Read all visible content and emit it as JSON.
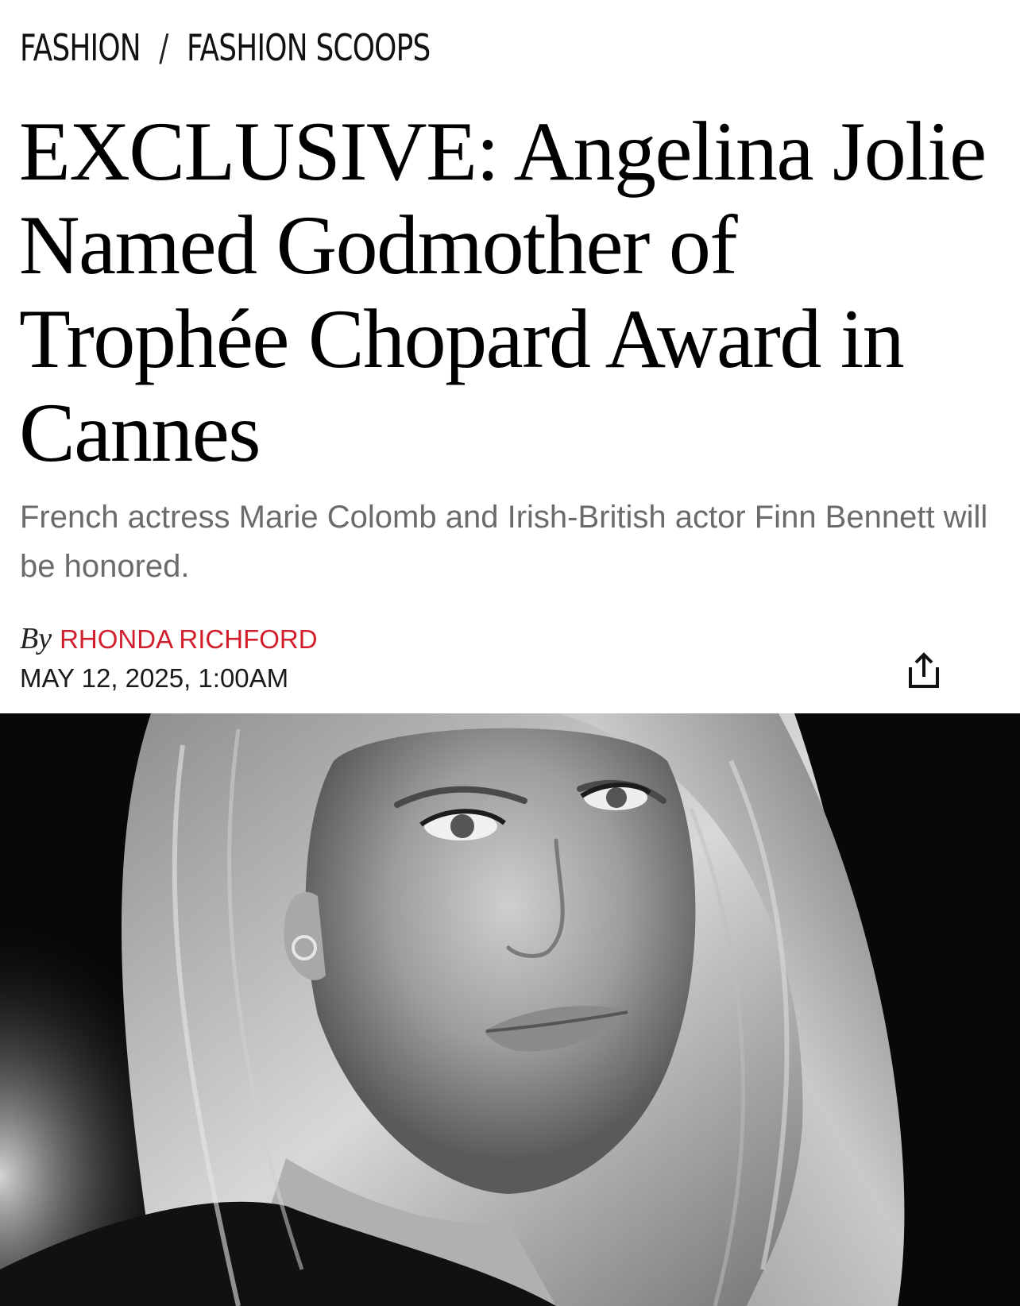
{
  "breadcrumb": {
    "items": [
      "FASHION",
      "FASHION SCOOPS"
    ],
    "separator": "/"
  },
  "article": {
    "headline": "EXCLUSIVE: Angelina Jolie Named Godmother of Trophée Chopard Award in Cannes",
    "dek": "French actress Marie Colomb and Irish-British actor Finn Bennett will be honored.",
    "byline_prefix": "By",
    "author": "RHONDA RICHFORD",
    "date": "MAY 12, 2025, 1:00AM"
  },
  "icons": {
    "share": "share-icon"
  },
  "colors": {
    "author": "#d11f2e",
    "dek": "#6b6b6b",
    "headline": "#000000"
  }
}
